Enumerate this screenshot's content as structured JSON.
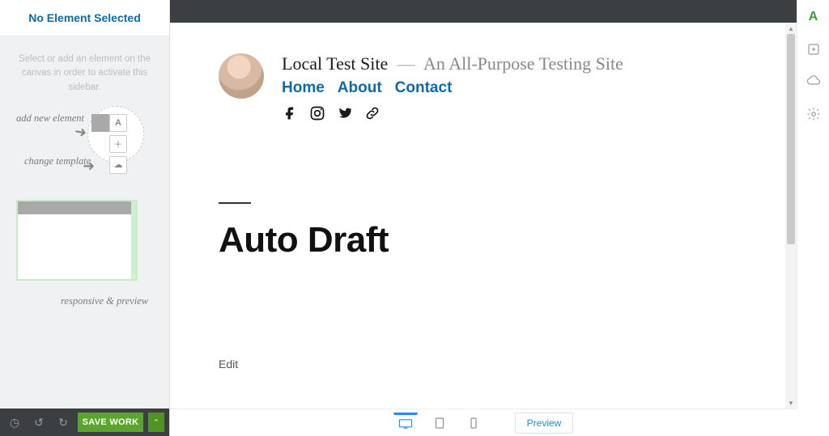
{
  "sidebar": {
    "header_title": "No Element Selected",
    "hint": "Select or add an element on the canvas in order to activate this sidebar.",
    "labels": {
      "add_new": "add new element",
      "change_tpl": "change template",
      "responsive": "responsive & preview"
    },
    "footer": {
      "save_label": "SAVE WORK"
    }
  },
  "rail": {
    "icons": [
      "logo",
      "add",
      "cloud",
      "settings"
    ]
  },
  "page": {
    "site_title": "Local Test Site",
    "separator": "—",
    "tagline": "An All-Purpose Testing Site",
    "nav": {
      "home": "Home",
      "about": "About",
      "contact": "Contact"
    },
    "post_title": "Auto Draft",
    "edit_label": "Edit"
  },
  "bottom": {
    "preview_label": "Preview"
  }
}
